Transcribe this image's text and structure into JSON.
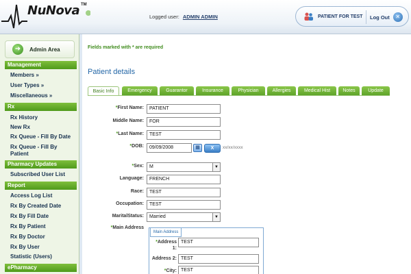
{
  "header": {
    "logo_text": "NuNova",
    "logo_tm": "TM",
    "logged_user_label": "Logged user:",
    "logged_user_name": "ADMIN ADMIN",
    "patient_button": "PATIENT FOR TEST",
    "logout_label": "Log Out"
  },
  "sidebar": {
    "admin_area": "Admin Area",
    "sections": [
      {
        "title": "Management",
        "items": [
          "Members »",
          "User Types »",
          "Miscellaneous »"
        ]
      },
      {
        "title": "Rx",
        "items": [
          "Rx History",
          "New Rx",
          "Rx Queue - Fill By Date",
          "Rx Queue - Fill By Patient"
        ]
      },
      {
        "title": "Pharmacy Updates",
        "items": [
          "Subscribed User List"
        ]
      },
      {
        "title": "Report",
        "items": [
          "Access Log List",
          "Rx By Created Date",
          "Rx By Fill Date",
          "Rx By Patient",
          "Rx By Doctor",
          "Rx By User",
          "Statistic (Users)"
        ]
      },
      {
        "title": "ePharmacy",
        "items": []
      }
    ]
  },
  "main": {
    "required_note": "Fields marked with * are required",
    "section_title": "Patient details",
    "tabs": [
      "Basic Info",
      "Emergency",
      "Guarantor",
      "Insurance",
      "Physician",
      "Allergies",
      "Medical Hist",
      "Notes",
      "Update"
    ],
    "active_tab": "Basic Info",
    "form": {
      "first_name": {
        "label": "First Name:",
        "value": "PATIENT",
        "required": true
      },
      "middle_name": {
        "label": "Middle Name:",
        "value": "FOR",
        "required": false
      },
      "last_name": {
        "label": "Last Name:",
        "value": "TEST",
        "required": true
      },
      "dob": {
        "label": "DOB:",
        "value": "09/09/2008",
        "required": true,
        "hint": "xx/xx/xxxx",
        "clear": "X"
      },
      "sex": {
        "label": "Sex:",
        "value": "M",
        "required": true
      },
      "language": {
        "label": "Language:",
        "value": "FRENCH"
      },
      "race": {
        "label": "Race:",
        "value": "TEST"
      },
      "occupation": {
        "label": "Occupation:",
        "value": "TEST"
      },
      "marital_status": {
        "label": "MaritalStatus:",
        "value": "Married"
      },
      "main_address_label": "Main Address",
      "address_legend": "Main Address",
      "address1": {
        "label_line1": "Address",
        "label_line2": "1:",
        "value": "TEST",
        "required": true
      },
      "address2": {
        "label": "Address 2:",
        "value": "TEST"
      },
      "city": {
        "label": "City:",
        "value": "TEST",
        "required": true
      }
    }
  },
  "colors": {
    "accent_green": "#5ea42a",
    "accent_blue": "#2467a7",
    "sidebar_bg": "#eef5e6"
  }
}
